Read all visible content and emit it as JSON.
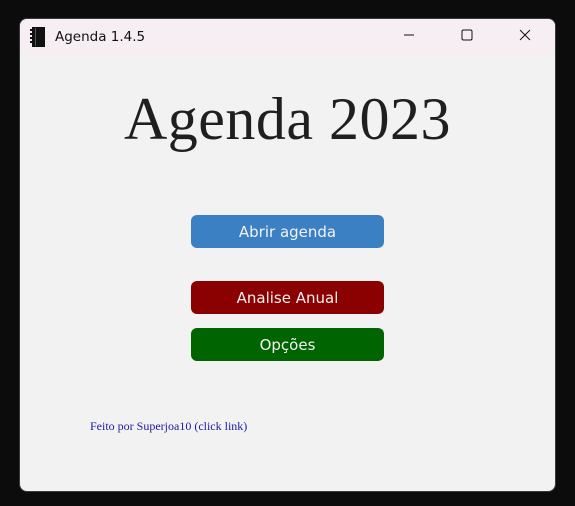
{
  "window": {
    "title": "Agenda 1.4.5",
    "icon": "notebook-icon",
    "controls": {
      "minimize": "minimize-icon",
      "maximize": "maximize-icon",
      "close": "close-icon"
    }
  },
  "main": {
    "heading": "Agenda 2023",
    "buttons": {
      "open_label": "Abrir agenda",
      "annual_label": "Analise Anual",
      "options_label": "Opções"
    },
    "footer_link": "Feito por Superjoa10 (click link)"
  },
  "colors": {
    "open_button": "#3b80c3",
    "annual_button": "#8b0000",
    "options_button": "#006400",
    "link": "#1a1aa6"
  }
}
